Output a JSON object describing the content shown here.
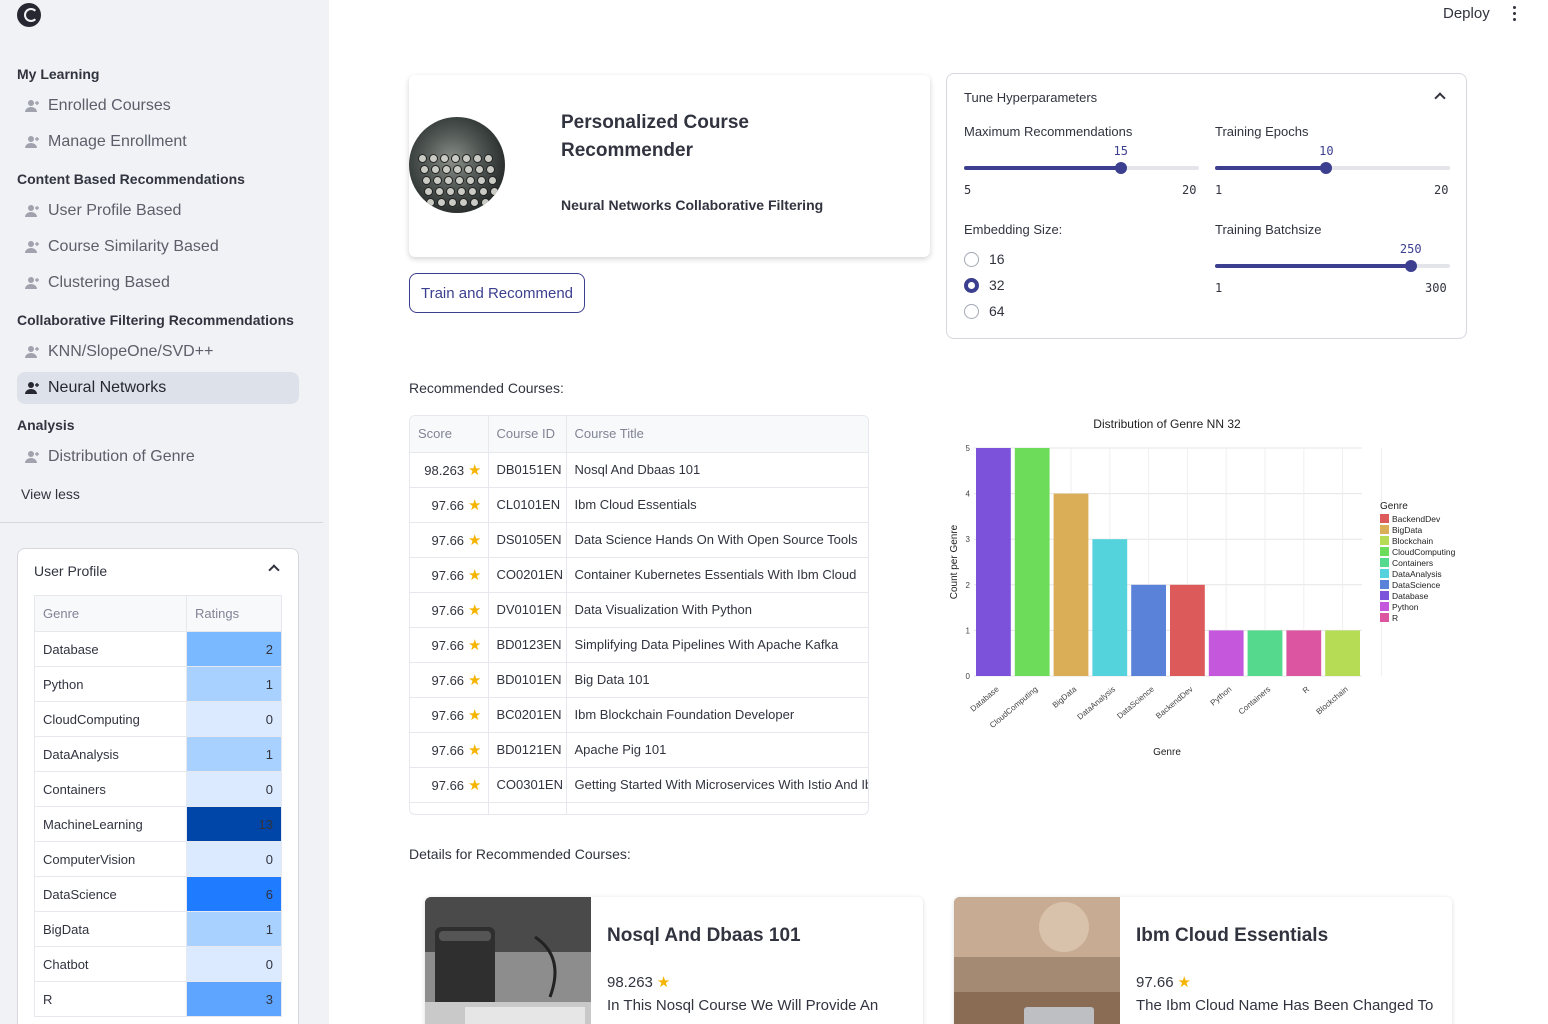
{
  "header": {
    "deploy_label": "Deploy"
  },
  "sidebar": {
    "sections": [
      {
        "title": "My Learning",
        "items": [
          "Enrolled Courses",
          "Manage Enrollment"
        ]
      },
      {
        "title": "Content Based Recommendations",
        "items": [
          "User Profile Based",
          "Course Similarity Based",
          "Clustering Based"
        ]
      },
      {
        "title": "Collaborative Filtering Recommendations",
        "items": [
          "KNN/SlopeOne/SVD++",
          "Neural Networks"
        ]
      },
      {
        "title": "Analysis",
        "items": [
          "Distribution of Genre"
        ]
      }
    ],
    "active_item": "Neural Networks",
    "view_less": "View less",
    "user_profile": {
      "title": "User Profile",
      "columns": [
        "Genre",
        "Ratings"
      ],
      "rows": [
        {
          "genre": "Database",
          "rating": "2",
          "color": "#7ab8ff"
        },
        {
          "genre": "Python",
          "rating": "1",
          "color": "#a9d1ff"
        },
        {
          "genre": "CloudComputing",
          "rating": "0",
          "color": "#dbeafe"
        },
        {
          "genre": "DataAnalysis",
          "rating": "1",
          "color": "#a9d1ff"
        },
        {
          "genre": "Containers",
          "rating": "0",
          "color": "#dbeafe"
        },
        {
          "genre": "MachineLearning",
          "rating": "13",
          "color": "#0046a8"
        },
        {
          "genre": "ComputerVision",
          "rating": "0",
          "color": "#dbeafe"
        },
        {
          "genre": "DataScience",
          "rating": "6",
          "color": "#1f7bff"
        },
        {
          "genre": "BigData",
          "rating": "1",
          "color": "#a9d1ff"
        },
        {
          "genre": "Chatbot",
          "rating": "0",
          "color": "#dbeafe"
        },
        {
          "genre": "R",
          "rating": "3",
          "color": "#5ea5ff"
        }
      ]
    }
  },
  "hero": {
    "title": "Personalized Course Recommender",
    "subtitle": "Neural Networks Collaborative Filtering"
  },
  "train_button": "Train and Recommend",
  "tune": {
    "title": "Tune Hyperparameters",
    "max_rec": {
      "label": "Maximum Recommendations",
      "value": "15",
      "min": "5",
      "max": "20",
      "fraction": 0.667
    },
    "epochs": {
      "label": "Training Epochs",
      "value": "10",
      "min": "1",
      "max": "20",
      "fraction": 0.474
    },
    "embedding": {
      "label": "Embedding Size:",
      "options": [
        "16",
        "32",
        "64"
      ],
      "selected": "32"
    },
    "batch": {
      "label": "Training Batchsize",
      "value": "250",
      "min": "1",
      "max": "300",
      "fraction": 0.833
    }
  },
  "recommended": {
    "label": "Recommended Courses:",
    "columns": [
      "Score",
      "Course ID",
      "Course Title"
    ],
    "rows": [
      {
        "score": "98.263",
        "id": "DB0151EN",
        "title": "Nosql And Dbaas 101"
      },
      {
        "score": "97.66",
        "id": "CL0101EN",
        "title": "Ibm Cloud Essentials"
      },
      {
        "score": "97.66",
        "id": "DS0105EN",
        "title": "Data Science Hands On With Open Source Tools"
      },
      {
        "score": "97.66",
        "id": "CO0201EN",
        "title": "Container   Kubernetes Essentials With Ibm Cloud"
      },
      {
        "score": "97.66",
        "id": "DV0101EN",
        "title": "Data Visualization With Python"
      },
      {
        "score": "97.66",
        "id": "BD0123EN",
        "title": "Simplifying Data Pipelines With Apache Kafka"
      },
      {
        "score": "97.66",
        "id": "BD0101EN",
        "title": "Big Data 101"
      },
      {
        "score": "97.66",
        "id": "BC0201EN",
        "title": "Ibm Blockchain Foundation Developer"
      },
      {
        "score": "97.66",
        "id": "BD0121EN",
        "title": "Apache Pig 101"
      },
      {
        "score": "97.66",
        "id": "CO0301EN",
        "title": "Getting Started With Microservices With Istio And Ib"
      }
    ]
  },
  "chart_data": {
    "type": "bar",
    "title": "Distribution of Genre NN 32",
    "xlabel": "Genre",
    "ylabel": "Count per Genre",
    "categories": [
      "Database",
      "CloudComputing",
      "BigData",
      "DataAnalysis",
      "DataScience",
      "BackendDev",
      "Python",
      "Containers",
      "R",
      "Blockchain"
    ],
    "values": [
      5,
      5,
      4,
      3,
      2,
      2,
      1,
      1,
      1,
      1
    ],
    "colors": [
      "#7b52d9",
      "#6ddc5a",
      "#d9ae57",
      "#54d3dc",
      "#5a82d9",
      "#dc5a5a",
      "#c557dc",
      "#55d98d",
      "#db55a1",
      "#b6dc55"
    ],
    "ylim": [
      0,
      5
    ],
    "yticks": [
      "0",
      "1",
      "2",
      "3",
      "4",
      "5"
    ],
    "legend": {
      "title": "Genre",
      "position": "right",
      "entries": [
        {
          "name": "BackendDev",
          "color": "#dc5a5a"
        },
        {
          "name": "BigData",
          "color": "#d9ae57"
        },
        {
          "name": "Blockchain",
          "color": "#b6dc55"
        },
        {
          "name": "CloudComputing",
          "color": "#6ddc5a"
        },
        {
          "name": "Containers",
          "color": "#55d98d"
        },
        {
          "name": "DataAnalysis",
          "color": "#54d3dc"
        },
        {
          "name": "DataScience",
          "color": "#5a82d9"
        },
        {
          "name": "Database",
          "color": "#7b52d9"
        },
        {
          "name": "Python",
          "color": "#c557dc"
        },
        {
          "name": "R",
          "color": "#db55a1"
        }
      ]
    },
    "grid": true
  },
  "details": {
    "label": "Details for Recommended Courses:",
    "cards": [
      {
        "title": "Nosql And Dbaas 101",
        "score": "98.263",
        "desc": "In This Nosql Course We Will Provide An"
      },
      {
        "title": "Ibm Cloud Essentials",
        "score": "97.66",
        "desc": "The Ibm Cloud Name Has Been Changed To"
      }
    ]
  }
}
